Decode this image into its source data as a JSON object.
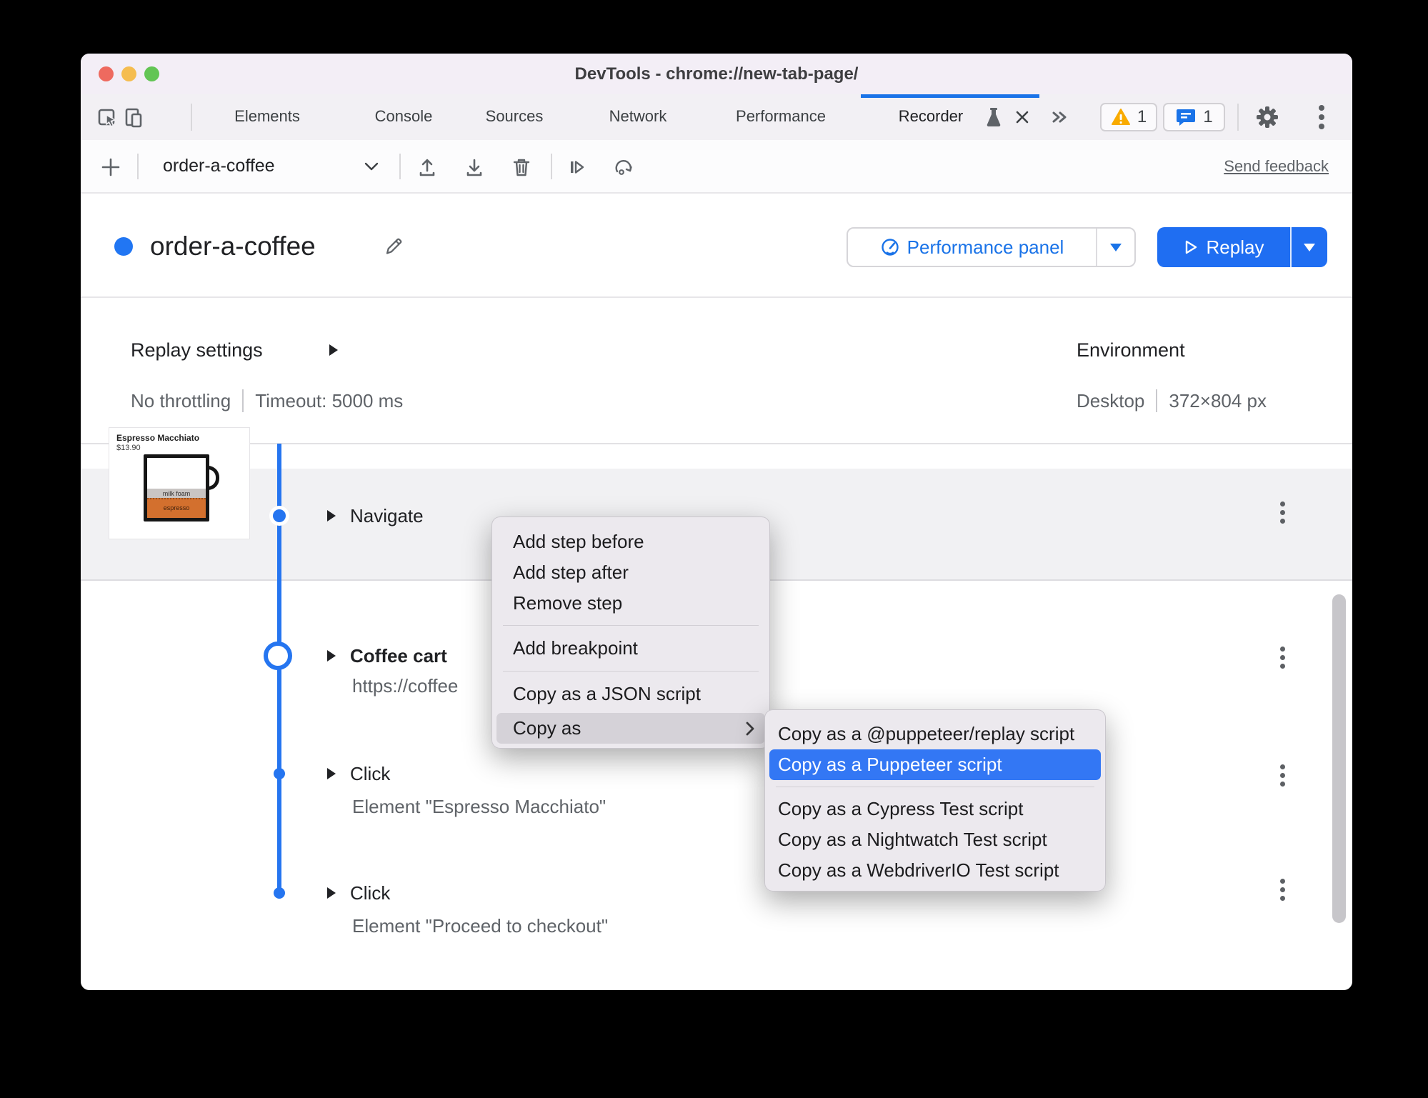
{
  "window": {
    "title": "DevTools - chrome://new-tab-page/"
  },
  "tabbar": {
    "tabs": [
      "Elements",
      "Console",
      "Sources",
      "Network",
      "Performance",
      "Recorder"
    ],
    "active_tab": "Recorder",
    "warning_count": "1",
    "message_count": "1"
  },
  "toolbar": {
    "recording_name": "order-a-coffee",
    "send_feedback": "Send feedback"
  },
  "header": {
    "recording_title": "order-a-coffee",
    "performance_button": "Performance panel",
    "replay_button": "Replay"
  },
  "settings": {
    "title": "Replay settings",
    "throttling": "No throttling",
    "timeout": "Timeout: 5000 ms"
  },
  "environment": {
    "title": "Environment",
    "device": "Desktop",
    "viewport": "372×804 px"
  },
  "thumbnail": {
    "product": "Espresso Macchiato",
    "price": "$13.90",
    "foam": "milk foam",
    "espresso": "espresso"
  },
  "steps": [
    {
      "title": "Navigate",
      "detail": "",
      "marker": "dot-ringed"
    },
    {
      "title": "Coffee cart",
      "detail": "https://coffee",
      "marker": "open-ring"
    },
    {
      "title": "Click",
      "detail": "Element \"Espresso Macchiato\"",
      "marker": "dot"
    },
    {
      "title": "Click",
      "detail": "Element \"Proceed to checkout\"",
      "marker": "dot"
    }
  ],
  "context_menu": {
    "items": [
      "Add step before",
      "Add step after",
      "Remove step",
      "Add breakpoint",
      "Copy as a JSON script",
      "Copy as"
    ],
    "hovered": "Copy as"
  },
  "submenu": {
    "items": [
      "Copy as a @puppeteer/replay script",
      "Copy as a Puppeteer script",
      "Copy as a Cypress Test script",
      "Copy as a Nightwatch Test script",
      "Copy as a WebdriverIO Test script"
    ],
    "highlighted": "Copy as a Puppeteer script"
  },
  "colors": {
    "accent_blue": "#1a73e8",
    "replay_button_blue": "#1f6ef2",
    "selection_blue": "#3377f4",
    "timeline_blue": "#2575f0",
    "titlebar_bg": "#f3eef6",
    "hover_row_gray": "#f1f1f3",
    "menu_bg": "#ece9ee",
    "warning_amber": "#f9ab00",
    "message_blue": "#1a73e8",
    "espresso_orange": "#d3702e",
    "foam_gray": "#c9c5c3"
  }
}
